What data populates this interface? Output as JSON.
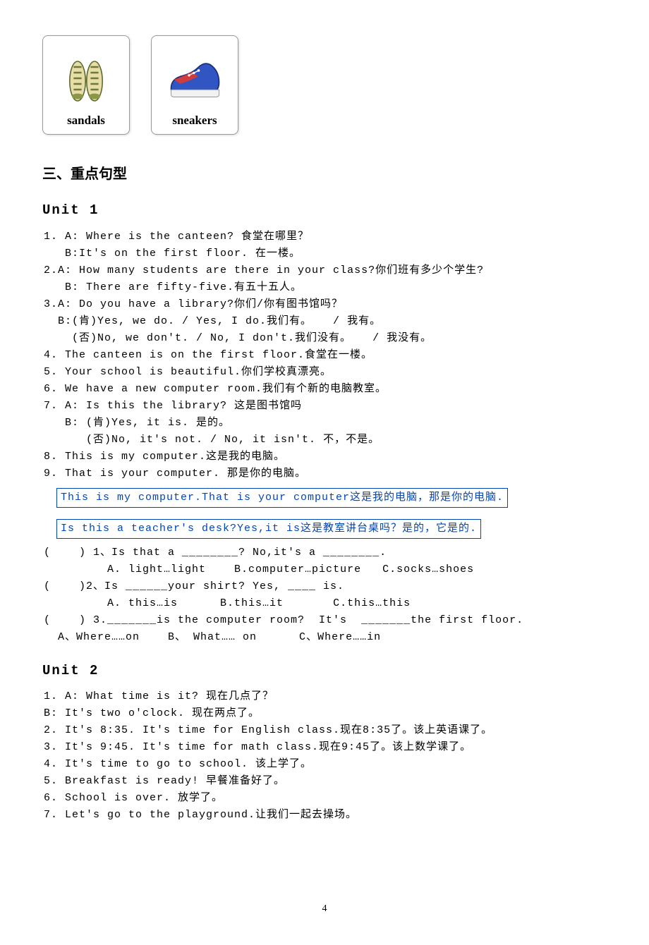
{
  "cards": [
    {
      "label": "sandals"
    },
    {
      "label": "sneakers"
    }
  ],
  "section_title": "三、重点句型",
  "unit1_title": "Unit 1",
  "unit1_lines": [
    "1. A: Where is the canteen? 食堂在哪里？",
    "   B:It's on the first floor. 在一楼。",
    "2.A: How many students are there in your class?你们班有多少个学生?",
    "   B: There are fifty-five.有五十五人。",
    "3.A: Do you have a library?你们/你有图书馆吗？",
    "  B:(肯)Yes, we do. / Yes, I do.我们有。   / 我有。",
    "    (否)No, we don't. / No, I don't.我们没有。   / 我没有。",
    "4. The canteen is on the first floor.食堂在一楼。",
    "5. Your school is beautiful.你们学校真漂亮。",
    "6. We have a new computer room.我们有个新的电脑教室。",
    "7. A: Is this the library? 这是图书馆吗",
    "   B: (肯)Yes, it is. 是的。",
    "      (否)No, it's not. / No, it isn't. 不，不是。",
    "8. This is my computer.这是我的电脑。",
    "9. That is your computer. 那是你的电脑。"
  ],
  "boxed1": "This is my computer.That is your computer这是我的电脑，那是你的电脑.",
  "boxed2": "Is this a teacher's desk?Yes,it is这是教室讲台桌吗？是的，它是的.",
  "quiz_lines": [
    "(    ) 1、Is that a ________? No,it's a ________.",
    "         A. light…light    B.computer…picture   C.socks…shoes",
    "(    )2、Is ______your shirt? Yes, ____ is.",
    "         A. this…is      B.this…it       C.this…this",
    "(    ) 3._______is the computer room?  It's  _______the first floor.",
    "  A、Where……on    B、 What…… on      C、Where……in"
  ],
  "unit2_title": "Unit 2",
  "unit2_lines": [
    "1. A: What time is it? 现在几点了？",
    "B: It's two o'clock. 现在两点了。",
    "2. It's 8:35. It's time for English class.现在8:35了。该上英语课了。",
    "3. It's 9:45. It's time for math class.现在9:45了。该上数学课了。",
    "4. It's time to go to school. 该上学了。",
    "5. Breakfast is ready! 早餐准备好了。",
    "6. School is over. 放学了。",
    "7. Let's go to the playground.让我们一起去操场。"
  ],
  "page_number": "4"
}
